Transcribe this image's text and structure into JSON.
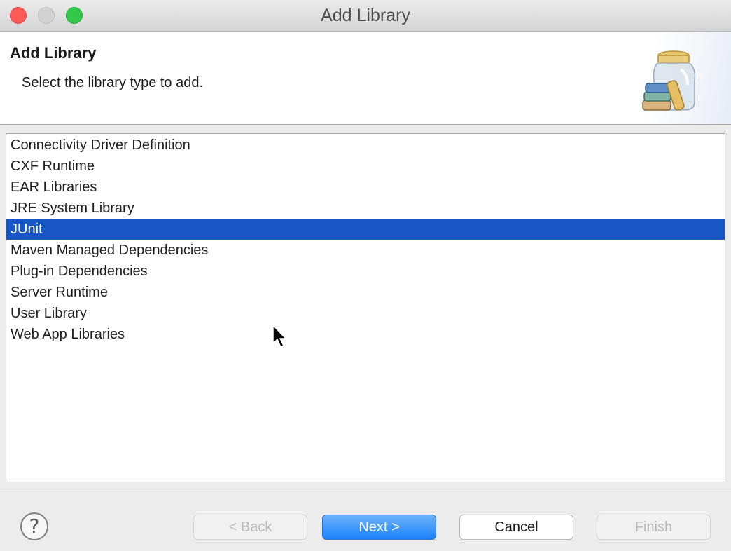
{
  "window": {
    "title": "Add Library"
  },
  "banner": {
    "title": "Add Library",
    "description": "Select the library type to add."
  },
  "library_types": [
    {
      "label": "Connectivity Driver Definition",
      "selected": false
    },
    {
      "label": "CXF Runtime",
      "selected": false
    },
    {
      "label": "EAR Libraries",
      "selected": false
    },
    {
      "label": "JRE System Library",
      "selected": false
    },
    {
      "label": "JUnit",
      "selected": true
    },
    {
      "label": "Maven Managed Dependencies",
      "selected": false
    },
    {
      "label": "Plug-in Dependencies",
      "selected": false
    },
    {
      "label": "Server Runtime",
      "selected": false
    },
    {
      "label": "User Library",
      "selected": false
    },
    {
      "label": "Web App Libraries",
      "selected": false
    }
  ],
  "footer": {
    "help_glyph": "?",
    "back_label": "< Back",
    "next_label": "Next >",
    "cancel_label": "Cancel",
    "finish_label": "Finish"
  },
  "colors": {
    "selection": "#1657c5",
    "primary_button": "#1a82fb",
    "close": "#fc5b57",
    "maximize": "#34c84a"
  },
  "icons": {
    "banner": "library-jar-icon",
    "help": "help-icon",
    "cursor": "mouse-cursor-icon"
  }
}
